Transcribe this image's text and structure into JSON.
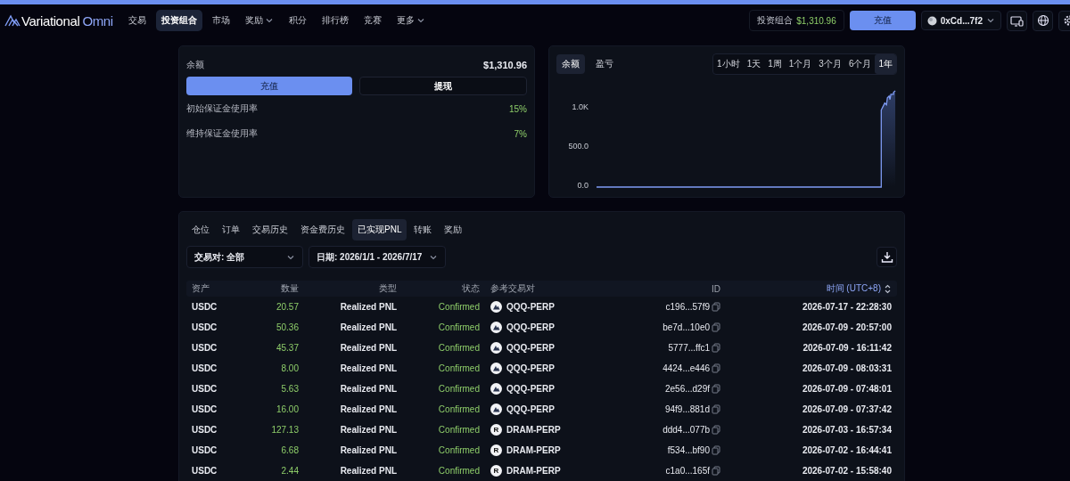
{
  "header": {
    "logo": {
      "brand": "Variational",
      "product": "Omni"
    },
    "nav": [
      {
        "label": "交易",
        "selected": false,
        "dropdown": false
      },
      {
        "label": "投资组合",
        "selected": true,
        "dropdown": false
      },
      {
        "label": "市场",
        "selected": false,
        "dropdown": false
      },
      {
        "label": "奖励",
        "selected": false,
        "dropdown": true
      },
      {
        "label": "积分",
        "selected": false,
        "dropdown": false
      },
      {
        "label": "排行榜",
        "selected": false,
        "dropdown": false
      },
      {
        "label": "竞赛",
        "selected": false,
        "dropdown": false
      },
      {
        "label": "更多",
        "selected": false,
        "dropdown": true
      }
    ],
    "portfolio": {
      "label": "投资组合",
      "value": "$1,310.96"
    },
    "deposit_button": "充值",
    "wallet": {
      "address": "0xCd...7f2"
    }
  },
  "balance_card": {
    "label": "余额",
    "value": "$1,310.96",
    "buttons": [
      {
        "label": "充值",
        "kind": "primary"
      },
      {
        "label": "提现",
        "kind": "secondary"
      }
    ],
    "metrics": [
      {
        "label": "初始保证金使用率",
        "value": "15%"
      },
      {
        "label": "维持保证金使用率",
        "value": "7%"
      }
    ]
  },
  "chart_card": {
    "tabs": [
      {
        "label": "余额",
        "selected": true
      },
      {
        "label": "盈亏",
        "selected": false
      }
    ],
    "ranges": [
      {
        "label": "1小时",
        "selected": false
      },
      {
        "label": "1天",
        "selected": false
      },
      {
        "label": "1周",
        "selected": false
      },
      {
        "label": "1个月",
        "selected": false
      },
      {
        "label": "3个月",
        "selected": false
      },
      {
        "label": "6个月",
        "selected": false
      },
      {
        "label": "1年",
        "selected": true
      }
    ],
    "y_tick_labels": [
      "1.0K",
      "500.0",
      "0.0"
    ]
  },
  "history": {
    "tabs": [
      {
        "label": "仓位",
        "selected": false
      },
      {
        "label": "订单",
        "selected": false
      },
      {
        "label": "交易历史",
        "selected": false
      },
      {
        "label": "资金费历史",
        "selected": false
      },
      {
        "label": "已实现PNL",
        "selected": true
      },
      {
        "label": "转账",
        "selected": false
      },
      {
        "label": "奖励",
        "selected": false
      }
    ],
    "filters": [
      {
        "label": "交易对: 全部"
      },
      {
        "label": "日期: 2026/1/1 - 2026/7/17"
      }
    ],
    "columns": [
      "资产",
      "数量",
      "类型",
      "状态",
      "参考交易对",
      "ID",
      "时间 (UTC+8)"
    ],
    "rows": [
      {
        "asset": "USDC",
        "amount": "20.57",
        "type": "Realized PNL",
        "status": "Confirmed",
        "pair": "QQQ-PERP",
        "pair_icon": {
          "kind": "mountain"
        },
        "id": "c196...57f9",
        "time": "2026-07-17 - 22:28:30"
      },
      {
        "asset": "USDC",
        "amount": "50.36",
        "type": "Realized PNL",
        "status": "Confirmed",
        "pair": "QQQ-PERP",
        "pair_icon": {
          "kind": "mountain"
        },
        "id": "be7d...10e0",
        "time": "2026-07-09 - 20:57:00"
      },
      {
        "asset": "USDC",
        "amount": "45.37",
        "type": "Realized PNL",
        "status": "Confirmed",
        "pair": "QQQ-PERP",
        "pair_icon": {
          "kind": "mountain"
        },
        "id": "5777...ffc1",
        "time": "2026-07-09 - 16:11:42"
      },
      {
        "asset": "USDC",
        "amount": "8.00",
        "type": "Realized PNL",
        "status": "Confirmed",
        "pair": "QQQ-PERP",
        "pair_icon": {
          "kind": "mountain"
        },
        "id": "4424...e446",
        "time": "2026-07-09 - 08:03:31"
      },
      {
        "asset": "USDC",
        "amount": "5.63",
        "type": "Realized PNL",
        "status": "Confirmed",
        "pair": "QQQ-PERP",
        "pair_icon": {
          "kind": "mountain"
        },
        "id": "2e56...d29f",
        "time": "2026-07-09 - 07:48:01"
      },
      {
        "asset": "USDC",
        "amount": "16.00",
        "type": "Realized PNL",
        "status": "Confirmed",
        "pair": "QQQ-PERP",
        "pair_icon": {
          "kind": "mountain"
        },
        "id": "94f9...881d",
        "time": "2026-07-09 - 07:37:42"
      },
      {
        "asset": "USDC",
        "amount": "127.13",
        "type": "Realized PNL",
        "status": "Confirmed",
        "pair": "DRAM-PERP",
        "pair_icon": {
          "kind": "letter",
          "text": "R"
        },
        "id": "ddd4...077b",
        "time": "2026-07-03 - 16:57:34"
      },
      {
        "asset": "USDC",
        "amount": "6.68",
        "type": "Realized PNL",
        "status": "Confirmed",
        "pair": "DRAM-PERP",
        "pair_icon": {
          "kind": "letter",
          "text": "R"
        },
        "id": "f534...bf90",
        "time": "2026-07-02 - 16:44:41"
      },
      {
        "asset": "USDC",
        "amount": "2.44",
        "type": "Realized PNL",
        "status": "Confirmed",
        "pair": "DRAM-PERP",
        "pair_icon": {
          "kind": "letter",
          "text": "R"
        },
        "id": "c1a0...165f",
        "time": "2026-07-02 - 15:58:40"
      }
    ]
  }
}
